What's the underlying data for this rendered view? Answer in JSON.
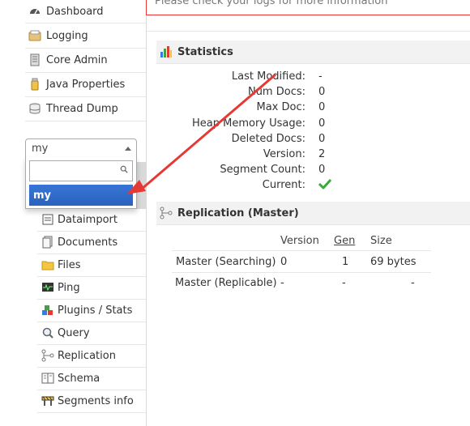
{
  "sidebar": {
    "items": [
      {
        "label": "Dashboard",
        "icon": "dashboard-icon"
      },
      {
        "label": "Logging",
        "icon": "logging-icon"
      },
      {
        "label": "Core Admin",
        "icon": "core-admin-icon"
      },
      {
        "label": "Java Properties",
        "icon": "java-properties-icon"
      },
      {
        "label": "Thread Dump",
        "icon": "thread-dump-icon"
      }
    ],
    "core_selector": {
      "selected": "my",
      "search_value": "",
      "options": [
        "my"
      ]
    },
    "core_menu": [
      {
        "label": "Dataimport",
        "icon": "dataimport-icon"
      },
      {
        "label": "Documents",
        "icon": "documents-icon"
      },
      {
        "label": "Files",
        "icon": "files-icon"
      },
      {
        "label": "Ping",
        "icon": "ping-icon"
      },
      {
        "label": "Plugins / Stats",
        "icon": "plugins-icon"
      },
      {
        "label": "Query",
        "icon": "query-icon"
      },
      {
        "label": "Replication",
        "icon": "replication-icon"
      },
      {
        "label": "Schema",
        "icon": "schema-icon"
      },
      {
        "label": "Segments info",
        "icon": "segments-icon"
      }
    ]
  },
  "notice": {
    "text": "Please check your logs for more information"
  },
  "statistics": {
    "title": "Statistics",
    "rows": [
      {
        "label": "Last Modified:",
        "value": "-"
      },
      {
        "label": "Num Docs:",
        "value": "0"
      },
      {
        "label": "Max Doc:",
        "value": "0"
      },
      {
        "label": "Heap Memory Usage:",
        "value": "0"
      },
      {
        "label": "Deleted Docs:",
        "value": "0"
      },
      {
        "label": "Version:",
        "value": "2"
      },
      {
        "label": "Segment Count:",
        "value": "0"
      },
      {
        "label": "Current:",
        "value": "",
        "icon": "checkmark-icon"
      }
    ]
  },
  "replication": {
    "title": "Replication (Master)",
    "headers": [
      "Version",
      "Gen",
      "Size"
    ],
    "rows": [
      {
        "label": "Master (Searching)",
        "version": "0",
        "gen": "1",
        "size": "69 bytes"
      },
      {
        "label": "Master (Replicable)",
        "version": "-",
        "gen": "-",
        "size": "-"
      }
    ]
  },
  "colors": {
    "accent": "#2a62bc",
    "arrow": "#e53935",
    "check": "#3aa83a",
    "notice_border": "#e33"
  }
}
